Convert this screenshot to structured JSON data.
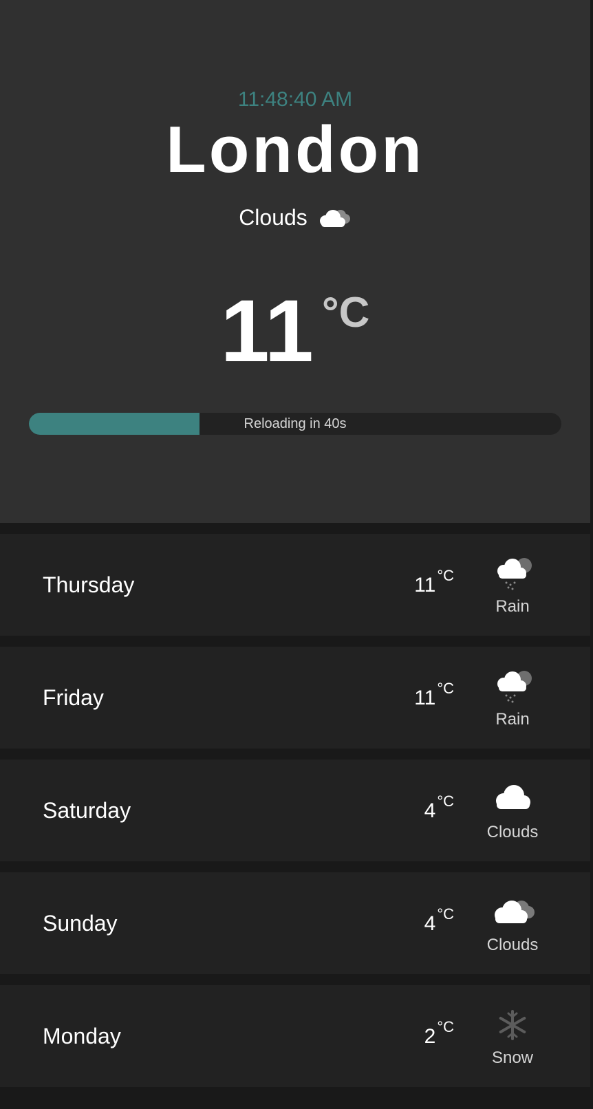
{
  "header": {
    "time": "11:48:40 AM",
    "city": "London",
    "condition": "Clouds",
    "condition_icon": "clouds-icon",
    "temperature": "11",
    "unit": "°C"
  },
  "reload": {
    "label": "Reloading in 40s",
    "progress_fraction": 0.32,
    "color": "#3d8280"
  },
  "forecast": [
    {
      "day": "Thursday",
      "temp": "11",
      "unit": "°C",
      "desc": "Rain",
      "icon": "rain-icon"
    },
    {
      "day": "Friday",
      "temp": "11",
      "unit": "°C",
      "desc": "Rain",
      "icon": "rain-icon"
    },
    {
      "day": "Saturday",
      "temp": "4",
      "unit": "°C",
      "desc": "Clouds",
      "icon": "cloud-icon"
    },
    {
      "day": "Sunday",
      "temp": "4",
      "unit": "°C",
      "desc": "Clouds",
      "icon": "clouds-icon"
    },
    {
      "day": "Monday",
      "temp": "2",
      "unit": "°C",
      "desc": "Snow",
      "icon": "snow-icon"
    }
  ],
  "colors": {
    "accent": "#3d8280",
    "hero_bg": "#303030",
    "row_bg": "#222222",
    "page_bg": "#191919"
  }
}
